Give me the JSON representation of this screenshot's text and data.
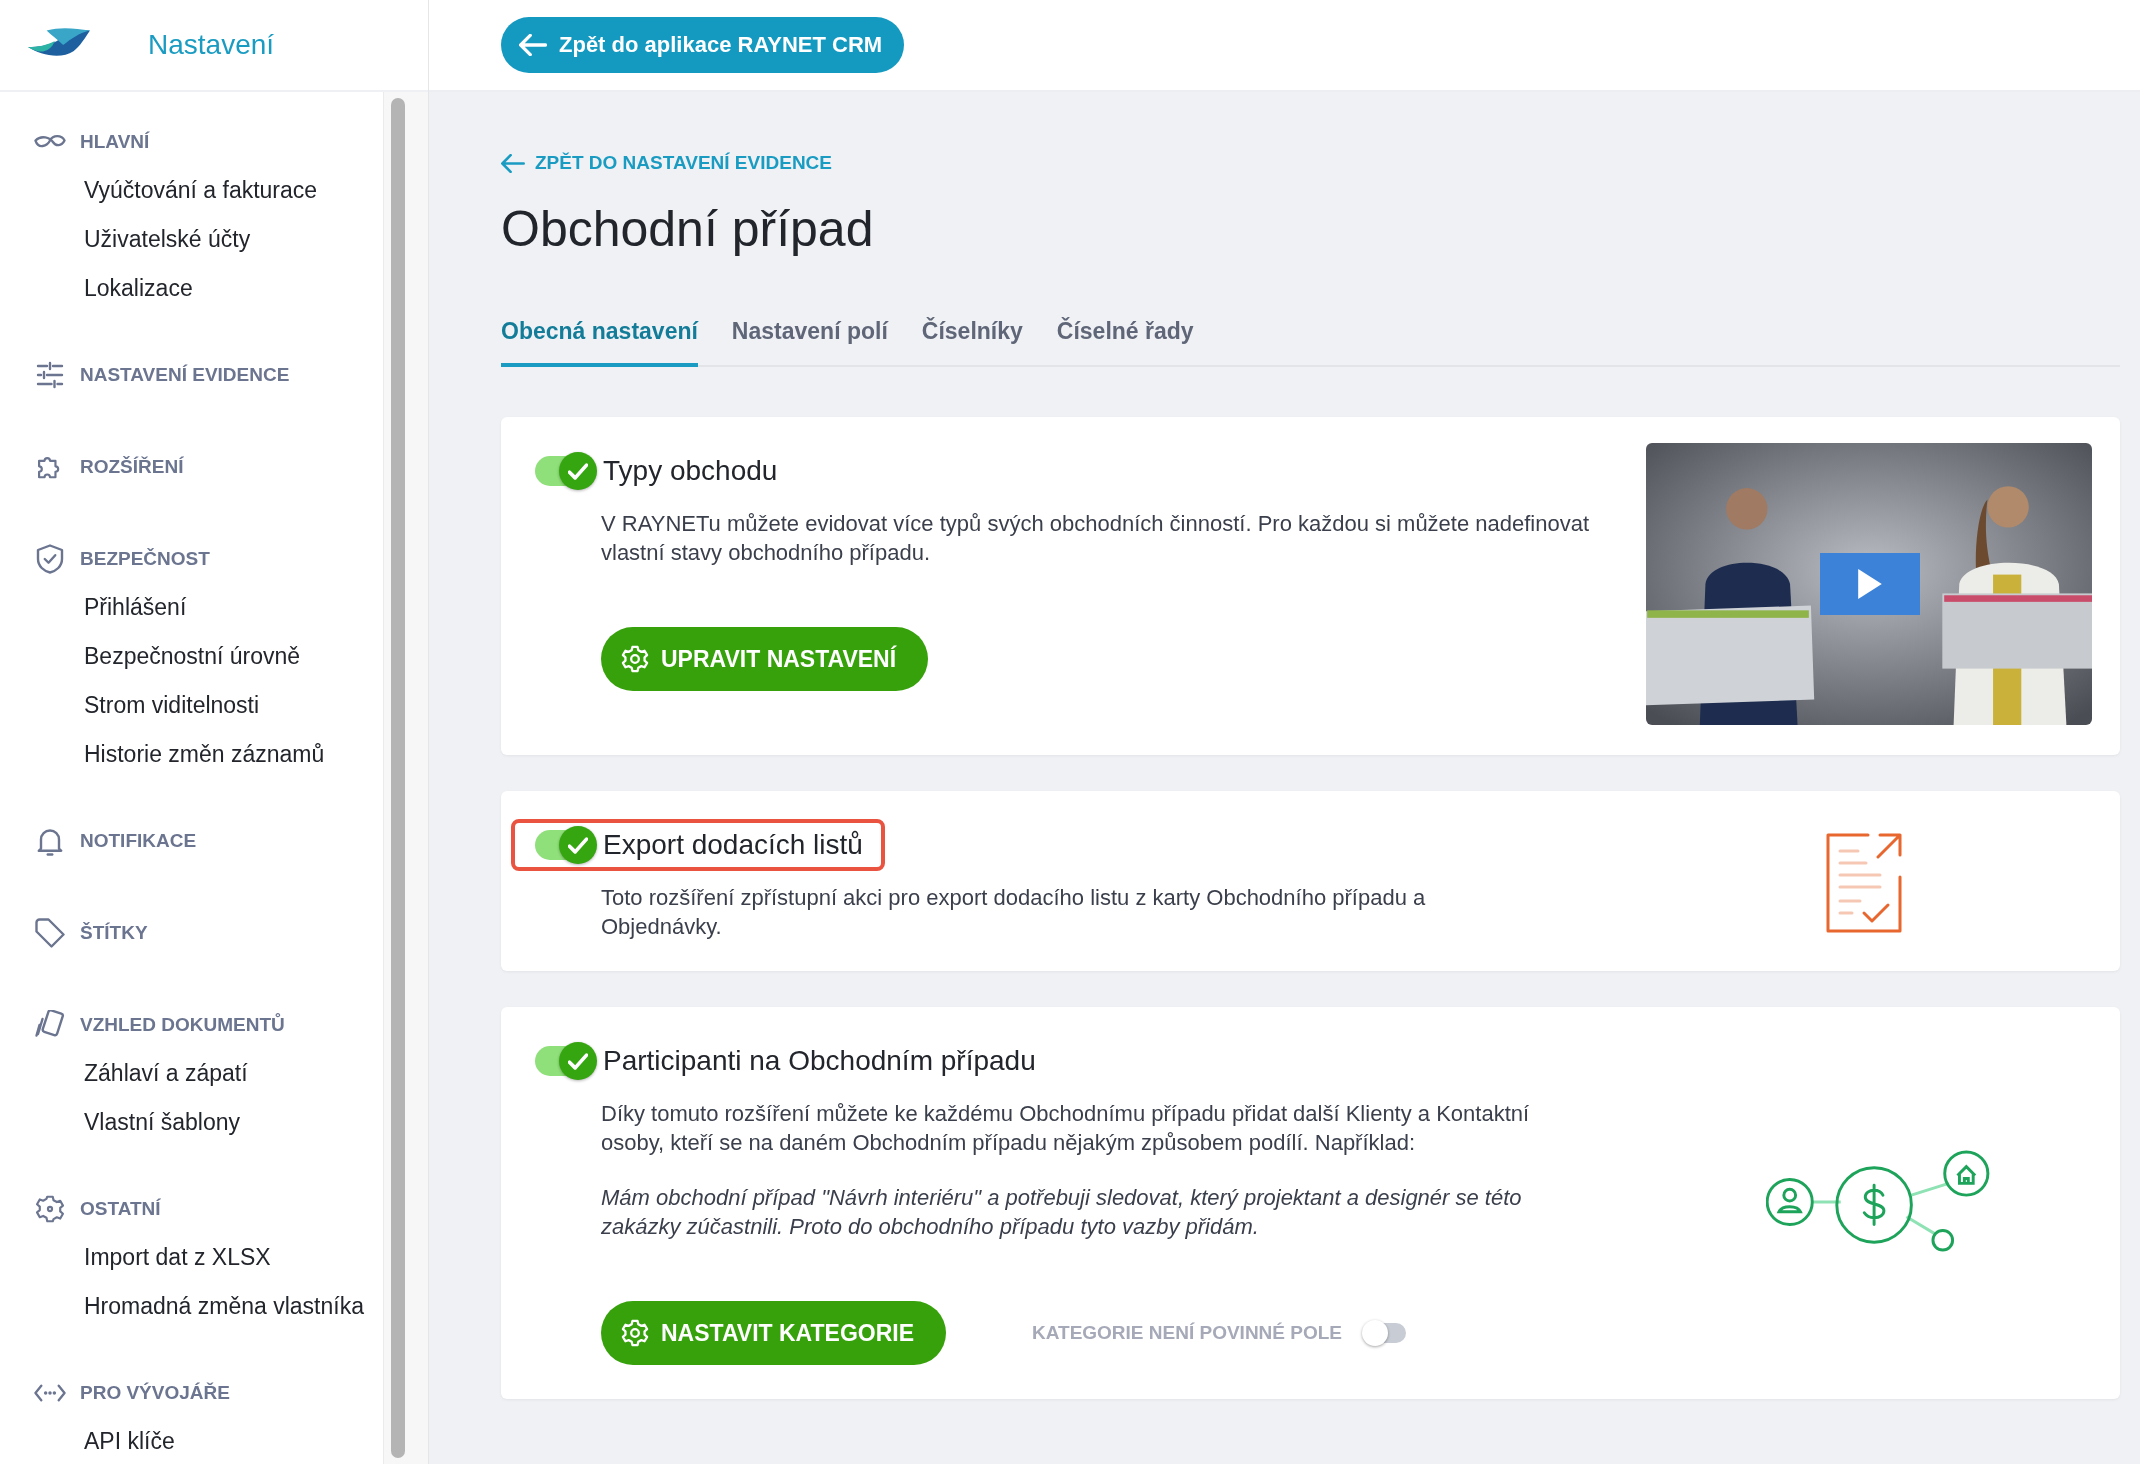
{
  "header": {
    "app_title": "Nastavení",
    "back_button": "Zpět do aplikace RAYNET CRM"
  },
  "sidebar": {
    "sections": [
      {
        "label": "HLAVNÍ",
        "items": [
          "Vyúčtování a fakturace",
          "Uživatelské účty",
          "Lokalizace"
        ]
      },
      {
        "label": "NASTAVENÍ EVIDENCE"
      },
      {
        "label": "ROZŠÍŘENÍ"
      },
      {
        "label": "BEZPEČNOST",
        "items": [
          "Přihlášení",
          "Bezpečnostní úrovně",
          "Strom viditelnosti",
          "Historie změn záznamů"
        ]
      },
      {
        "label": "NOTIFIKACE"
      },
      {
        "label": "ŠTÍTKY"
      },
      {
        "label": "VZHLED DOKUMENTŮ",
        "items": [
          "Záhlaví a zápatí",
          "Vlastní šablony"
        ]
      },
      {
        "label": "OSTATNÍ",
        "items": [
          "Import dat z XLSX",
          "Hromadná změna vlastníka"
        ]
      },
      {
        "label": "PRO VÝVOJÁŘE",
        "items": [
          "API klíče"
        ]
      }
    ]
  },
  "breadcrumb": "ZPĚT DO NASTAVENÍ EVIDENCE",
  "page_title": "Obchodní případ",
  "tabs": [
    {
      "label": "Obecná nastavení",
      "selected": true
    },
    {
      "label": "Nastavení polí",
      "selected": false
    },
    {
      "label": "Číselníky",
      "selected": false
    },
    {
      "label": "Číselné řady",
      "selected": false
    }
  ],
  "cards": [
    {
      "kind": "video",
      "title": "Typy obchodu",
      "on": true,
      "highlighted": false,
      "paragraphs": [
        {
          "kind": "normal",
          "text": "V RAYNETu můžete evidovat více typů svých obchodních činností. Pro každou si můžete nadefinovat vlastní stavy obchodního případu."
        }
      ],
      "button": "UPRAVIT NASTAVENÍ"
    },
    {
      "kind": "document",
      "title": "Export dodacích listů",
      "on": true,
      "highlighted": true,
      "paragraphs": [
        {
          "kind": "normal",
          "text": "Toto rozšíření zpřístupní akci pro export dodacího listu z karty Obchodního případu a Objednávky."
        }
      ]
    },
    {
      "kind": "network",
      "title": "Participanti na Obchodním případu",
      "on": true,
      "highlighted": false,
      "paragraphs": [
        {
          "kind": "normal",
          "text": "Díky tomuto rozšíření můžete ke každému Obchodnímu případu přidat další Klienty a Kontaktní osoby, kteří se na daném Obchodním případu nějakým způsobem podílí. Například:"
        },
        {
          "kind": "example",
          "text": "Mám obchodní případ \"Návrh interiéru\" a potřebuji sledovat, který projektant a designér se této zakázky zúčastnili. Proto do obchodního případu tyto vazby přidám."
        }
      ],
      "button": "NASTAVIT KATEGORIE",
      "option": {
        "label": "KATEGORIE NENÍ POVINNÉ POLE",
        "on": false
      }
    }
  ]
}
